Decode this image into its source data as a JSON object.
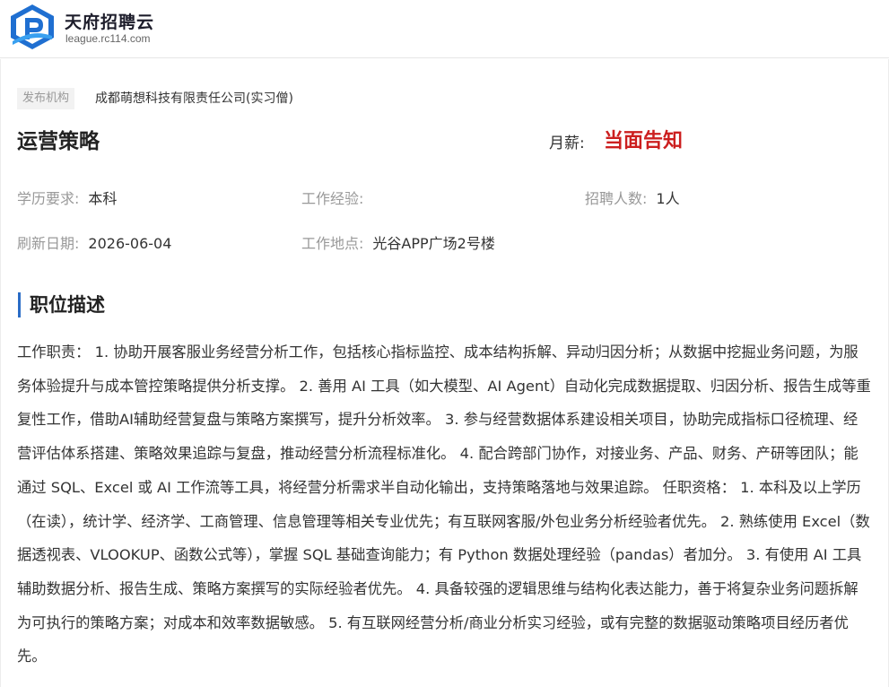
{
  "header": {
    "logo_title": "天府招聘云",
    "logo_url": "league.rc114.com"
  },
  "job": {
    "publisher_label": "发布机构",
    "publisher_name": "成都萌想科技有限责任公司(实习僧)",
    "title": "运营策略",
    "salary_label": "月薪:",
    "salary_value": "当面告知",
    "fields": {
      "education": {
        "label": "学历要求:",
        "value": "本科"
      },
      "experience": {
        "label": "工作经验:",
        "value": ""
      },
      "headcount": {
        "label": "招聘人数:",
        "value": "1人"
      },
      "refresh_date": {
        "label": "刷新日期:",
        "value": "2026-06-04"
      },
      "location": {
        "label": "工作地点:",
        "value": "光谷APP广场2号楼"
      }
    }
  },
  "description": {
    "section_title": "职位描述",
    "text": "工作职责： 1. 协助开展客服业务经营分析工作，包括核心指标监控、成本结构拆解、异动归因分析；从数据中挖掘业务问题，为服务体验提升与成本管控策略提供分析支撑。 2. 善用 AI 工具（如大模型、AI Agent）自动化完成数据提取、归因分析、报告生成等重复性工作，借助AI辅助经营复盘与策略方案撰写，提升分析效率。 3. 参与经营数据体系建设相关项目，协助完成指标口径梳理、经营评估体系搭建、策略效果追踪与复盘，推动经营分析流程标准化。 4. 配合跨部门协作，对接业务、产品、财务、产研等团队；能通过 SQL、Excel 或 AI 工作流等工具，将经营分析需求半自动化输出，支持策略落地与效果追踪。 任职资格： 1. 本科及以上学历（在读），统计学、经济学、工商管理、信息管理等相关专业优先；有互联网客服/外包业务分析经验者优先。 2. 熟练使用 Excel（数据透视表、VLOOKUP、函数公式等），掌握 SQL 基础查询能力；有 Python 数据处理经验（pandas）者加分。 3. 有使用 AI 工具辅助数据分析、报告生成、策略方案撰写的实际经验者优先。 4. 具备较强的逻辑思维与结构化表达能力，善于将复杂业务问题拆解为可执行的策略方案；对成本和效率数据敏感。 5. 有互联网经营分析/商业分析实习经验，或有完整的数据驱动策略项目经历者优先。"
  },
  "colors": {
    "salary": "#cc1f1f",
    "accent": "#2a6cc6",
    "logo_blue": "#1f6fd1"
  },
  "icons": {
    "logo": "rc114-logo-mark-icon"
  }
}
